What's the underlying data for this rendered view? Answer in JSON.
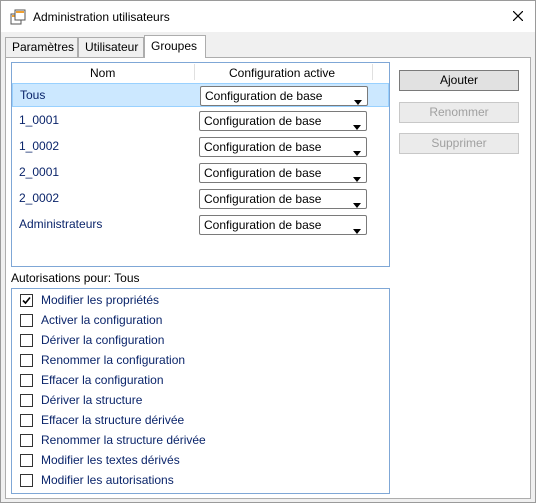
{
  "window": {
    "title": "Administration utilisateurs"
  },
  "tabs": [
    {
      "label": "Paramètres"
    },
    {
      "label": "Utilisateur"
    },
    {
      "label": "Groupes"
    }
  ],
  "grid": {
    "columns": {
      "name": "Nom",
      "config": "Configuration active"
    },
    "rows": [
      {
        "name": "Tous",
        "config": "Configuration de base",
        "selected": true
      },
      {
        "name": "1_0001",
        "config": "Configuration de base"
      },
      {
        "name": "1_0002",
        "config": "Configuration de base"
      },
      {
        "name": "2_0001",
        "config": "Configuration de base"
      },
      {
        "name": "2_0002",
        "config": "Configuration de base"
      },
      {
        "name": "Administrateurs",
        "config": "Configuration de base"
      }
    ]
  },
  "buttons": {
    "add": "Ajouter",
    "rename": "Renommer",
    "delete": "Supprimer"
  },
  "permissions": {
    "label": "Autorisations pour: Tous",
    "items": [
      {
        "label": "Modifier les propriétés",
        "checked": true
      },
      {
        "label": "Activer la configuration",
        "checked": false
      },
      {
        "label": "Dériver la configuration",
        "checked": false
      },
      {
        "label": "Renommer la configuration",
        "checked": false
      },
      {
        "label": "Effacer la configuration",
        "checked": false
      },
      {
        "label": "Dériver la structure",
        "checked": false
      },
      {
        "label": "Effacer la structure dérivée",
        "checked": false
      },
      {
        "label": "Renommer la structure dérivée",
        "checked": false
      },
      {
        "label": "Modifier les textes dérivés",
        "checked": false
      },
      {
        "label": "Modifier les autorisations",
        "checked": false
      }
    ]
  },
  "icons": {
    "app": "app-window-icon",
    "close": "close-icon",
    "dropdown": "chevron-down-icon",
    "check": "checkmark-icon"
  }
}
